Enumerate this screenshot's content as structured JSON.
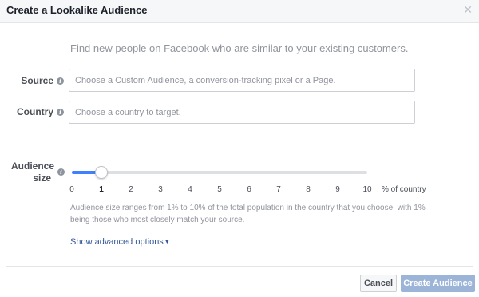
{
  "dialog": {
    "title": "Create a Lookalike Audience",
    "close_icon": "close-icon",
    "intro": "Find new people on Facebook who are similar to your existing customers."
  },
  "source": {
    "label": "Source",
    "placeholder": "Choose a Custom Audience, a conversion-tracking pixel or a Page.",
    "value": ""
  },
  "country": {
    "label": "Country",
    "placeholder": "Choose a country to target.",
    "value": ""
  },
  "audience_size": {
    "label_line1": "Audience",
    "label_line2": "size",
    "ticks": [
      "0",
      "1",
      "2",
      "3",
      "4",
      "5",
      "6",
      "7",
      "8",
      "9",
      "10"
    ],
    "selected_value": 1,
    "max_value": 10,
    "unit_label": "% of country",
    "description": "Audience size ranges from 1% to 10% of the total population in the country that you choose, with 1% being those who most closely match your source."
  },
  "advanced_link": "Show advanced options",
  "footer": {
    "cancel_label": "Cancel",
    "create_label": "Create Audience"
  },
  "colors": {
    "accent": "#4080ff",
    "link": "#365899",
    "create_button_disabled": "#9cb4d8"
  }
}
